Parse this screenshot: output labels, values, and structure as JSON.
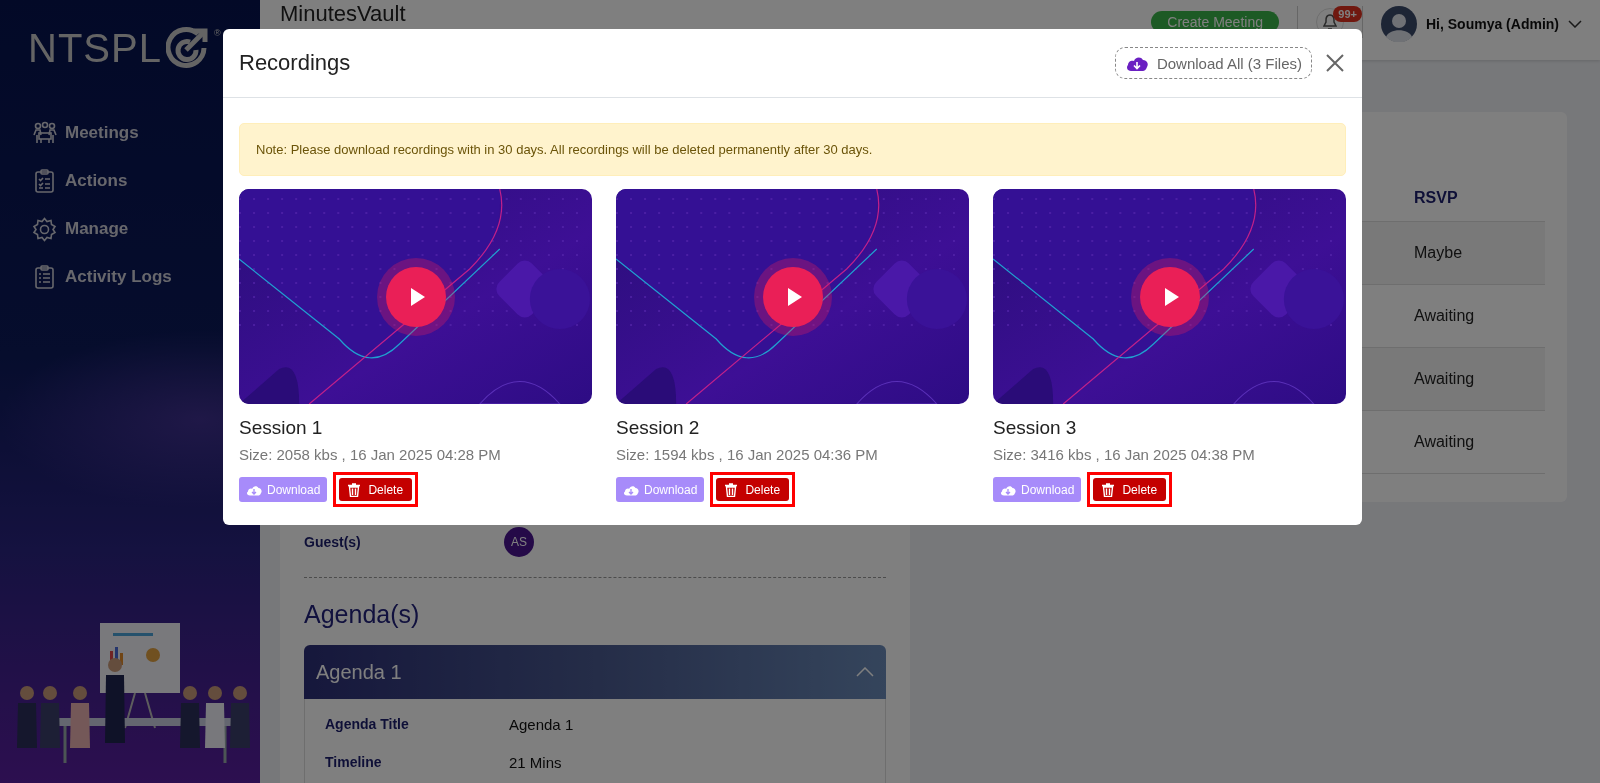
{
  "sidebar": {
    "logo": "NTSPL",
    "logo_mark": "®",
    "items": [
      {
        "label": "Meetings"
      },
      {
        "label": "Actions"
      },
      {
        "label": "Manage"
      },
      {
        "label": "Activity Logs"
      }
    ]
  },
  "topbar": {
    "title": "MinutesVault",
    "create_button": "Create Meeting",
    "notification_badge": "99+",
    "user": "Hi, Soumya (Admin)"
  },
  "meeting": {
    "guests_label": "Guest(s)",
    "guests": [
      "AS"
    ],
    "agenda_heading": "Agenda(s)",
    "agenda": {
      "title": "Agenda 1",
      "expanded": true,
      "fields": [
        {
          "label": "Agenda Title",
          "value": "Agenda 1"
        },
        {
          "label": "Timeline",
          "value": "21 Mins"
        }
      ]
    }
  },
  "attendees": {
    "columns": [
      "RSVP"
    ],
    "rows": [
      {
        "rsvp": "Maybe"
      },
      {
        "rsvp": "Awaiting"
      },
      {
        "rsvp": "Awaiting"
      },
      {
        "rsvp": "Awaiting"
      }
    ]
  },
  "modal": {
    "title": "Recordings",
    "download_all": "Download All (3 Files)",
    "note": "Note: Please download recordings with in 30 days. All recordings will be deleted permanently after 30 days.",
    "recordings": [
      {
        "title": "Session 1",
        "meta": "Size: 2058 kbs , 16 Jan 2025 04:28 PM",
        "download": "Download",
        "delete": "Delete",
        "highlighted": true
      },
      {
        "title": "Session 2",
        "meta": "Size: 1594 kbs , 16 Jan 2025 04:36 PM",
        "download": "Download",
        "delete": "Delete",
        "highlighted": true
      },
      {
        "title": "Session 3",
        "meta": "Size: 3416 kbs , 16 Jan 2025 04:38 PM",
        "download": "Download",
        "delete": "Delete",
        "highlighted": true
      }
    ]
  }
}
